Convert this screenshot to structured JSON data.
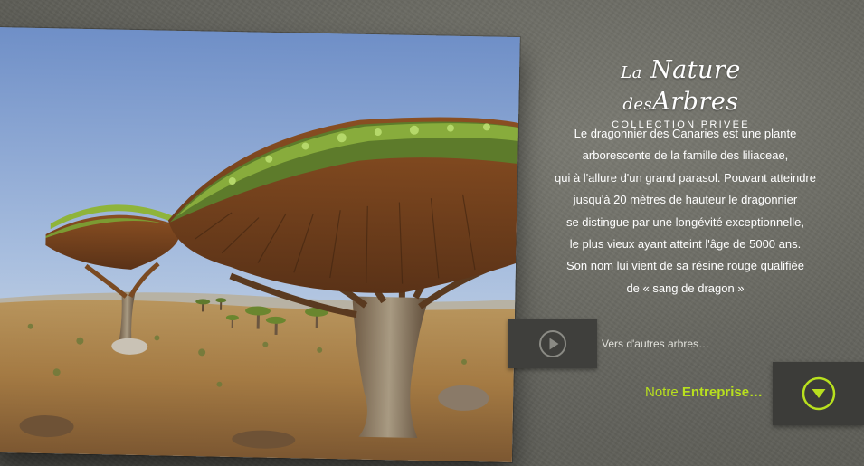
{
  "brand": {
    "title_part1": "La",
    "title_part2": "Nature",
    "title_part3": "des",
    "title_part4": "Arbres",
    "subtitle": "COLLECTION PRIVÉE"
  },
  "description": {
    "lines": [
      "Le dragonnier des Canaries est une plante",
      "arborescente de la famille des liliaceae,",
      "qui à l'allure d'un grand parasol. Pouvant atteindre",
      "jusqu'à 20 mètres de hauteur le dragonnier",
      "se distingue par une longévité exceptionnelle,",
      "le plus vieux ayant atteint l'âge de 5000 ans.",
      "Son nom lui vient de sa résine rouge qualifiée",
      "de « sang de dragon »"
    ]
  },
  "navigation": {
    "play_icon": "play-circle-icon",
    "more_trees_label": "Vers d'autres arbres…",
    "company_prefix": "Notre",
    "company_emphasis": "Entreprise…",
    "down_icon": "chevron-down-circle-icon"
  },
  "colors": {
    "accent_green": "#b8e01e",
    "background": "#66665f",
    "button_bg": "#3f3f3c"
  }
}
